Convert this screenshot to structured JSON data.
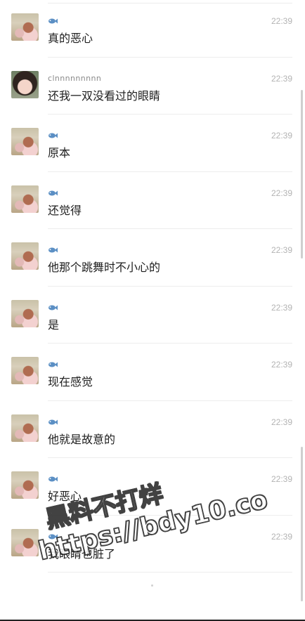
{
  "messages": [
    {
      "sender": "",
      "badge": "fish-icon",
      "avatar": "baby",
      "time": "22:39",
      "text": "真的恶心"
    },
    {
      "sender": "clnnnnnnnnn",
      "badge": "",
      "avatar": "girl",
      "time": "22:39",
      "text": "还我一双没看过的眼睛"
    },
    {
      "sender": "",
      "badge": "fish-icon",
      "avatar": "baby",
      "time": "22:39",
      "text": "原本"
    },
    {
      "sender": "",
      "badge": "fish-icon",
      "avatar": "baby",
      "time": "22:39",
      "text": "还觉得"
    },
    {
      "sender": "",
      "badge": "fish-icon",
      "avatar": "baby",
      "time": "22:39",
      "text": "他那个跳舞时不小心的"
    },
    {
      "sender": "",
      "badge": "fish-icon",
      "avatar": "baby",
      "time": "22:39",
      "text": "是"
    },
    {
      "sender": "",
      "badge": "fish-icon",
      "avatar": "baby",
      "time": "22:39",
      "text": "现在感觉"
    },
    {
      "sender": "",
      "badge": "fish-icon",
      "avatar": "baby",
      "time": "22:39",
      "text": "他就是故意的"
    },
    {
      "sender": "",
      "badge": "fish-icon",
      "avatar": "baby",
      "time": "22:39",
      "text": "好恶心"
    },
    {
      "sender": "",
      "badge": "fish-icon",
      "avatar": "baby",
      "time": "22:39",
      "text": "我眼睛也脏了"
    }
  ],
  "watermark": {
    "line1": "黑料不打烊",
    "line2": "https://bdy10.co"
  },
  "colors": {
    "time": "#b3b3b3",
    "sender": "#8a8a8a",
    "text": "#1e1e1e",
    "fish": "#5b8fc4"
  }
}
